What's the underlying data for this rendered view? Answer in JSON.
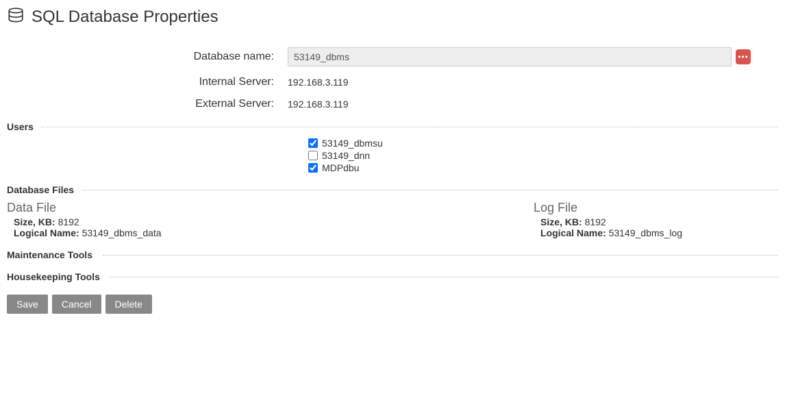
{
  "page": {
    "title": "SQL Database Properties"
  },
  "form": {
    "dbname_label": "Database name:",
    "dbname_value": "53149_dbms",
    "internal_label": "Internal Server:",
    "internal_value": "192.168.3.119",
    "external_label": "External Server:",
    "external_value": "192.168.3.119"
  },
  "sections": {
    "users": "Users",
    "dbfiles": "Database Files",
    "maint": "Maintenance Tools",
    "house": "Housekeeping Tools"
  },
  "users": [
    {
      "label": "53149_dbmsu",
      "checked": true
    },
    {
      "label": "53149_dnn",
      "checked": false
    },
    {
      "label": "MDPdbu",
      "checked": true
    }
  ],
  "files": {
    "data": {
      "title": "Data File",
      "size_label": "Size, KB:",
      "size_value": "8192",
      "name_label": "Logical Name:",
      "name_value": "53149_dbms_data"
    },
    "log": {
      "title": "Log File",
      "size_label": "Size, KB:",
      "size_value": "8192",
      "name_label": "Logical Name:",
      "name_value": "53149_dbms_log"
    }
  },
  "buttons": {
    "save": "Save",
    "cancel": "Cancel",
    "delete": "Delete"
  }
}
